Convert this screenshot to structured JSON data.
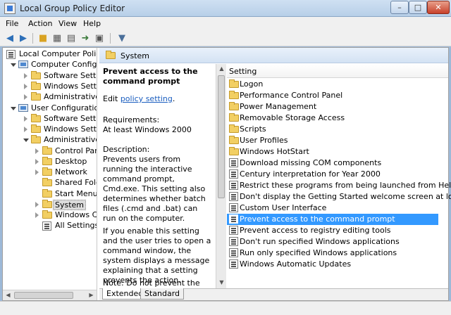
{
  "window": {
    "title": "Local Group Policy Editor",
    "controls": {
      "minimize": "–",
      "maximize": "□",
      "close": "✕"
    }
  },
  "menu": [
    "File",
    "Action",
    "View",
    "Help"
  ],
  "toolbar": {
    "icons": [
      "back-arrow-icon",
      "forward-arrow-icon",
      "folder-up-icon",
      "show-hide-tree-icon",
      "export-list-icon",
      "help-icon",
      "filter-icon"
    ]
  },
  "tree": {
    "items": [
      {
        "label": "Local Computer Policy",
        "icon": "policy-icon"
      },
      {
        "label": "Computer Configura",
        "icon": "computer-icon"
      },
      {
        "label": "Software Settings",
        "icon": "folder-icon"
      },
      {
        "label": "Windows Setting",
        "icon": "folder-icon"
      },
      {
        "label": "Administrative Te",
        "icon": "folder-icon"
      },
      {
        "label": "User Configuration",
        "icon": "computer-icon"
      },
      {
        "label": "Software Settings",
        "icon": "folder-icon"
      },
      {
        "label": "Windows Setting",
        "icon": "folder-icon"
      },
      {
        "label": "Administrative Te",
        "icon": "folder-icon"
      },
      {
        "label": "Control Panel",
        "icon": "folder-icon"
      },
      {
        "label": "Desktop",
        "icon": "folder-icon"
      },
      {
        "label": "Network",
        "icon": "folder-icon"
      },
      {
        "label": "Shared Folder",
        "icon": "folder-icon"
      },
      {
        "label": "Start Menu ar",
        "icon": "folder-icon"
      },
      {
        "label": "System",
        "icon": "folder-icon",
        "selected": true
      },
      {
        "label": "Windows Cor",
        "icon": "folder-icon"
      },
      {
        "label": "All Settings",
        "icon": "settings-icon"
      }
    ]
  },
  "panel": {
    "title": "System",
    "description": {
      "heading": "Prevent access to the command prompt",
      "edit_prefix": "Edit ",
      "edit_link": "policy setting",
      "edit_suffix": ".",
      "requirements_label": "Requirements:",
      "requirements_value": "At least Windows 2000",
      "description_label": "Description:",
      "description_p1": "Prevents users from running the interactive command prompt, Cmd.exe. This setting also determines whether batch files (.cmd and .bat) can run on the computer.",
      "description_p2": "If you enable this setting and the user tries to open a command window, the system displays a message explaining that a setting prevents the action.",
      "description_p3": "Note: Do not prevent the computer from running batch files if the computer uses logon"
    },
    "list_header": "Setting",
    "settings": [
      {
        "label": "Logon",
        "icon": "folder-icon"
      },
      {
        "label": "Performance Control Panel",
        "icon": "folder-icon"
      },
      {
        "label": "Power Management",
        "icon": "folder-icon"
      },
      {
        "label": "Removable Storage Access",
        "icon": "folder-icon"
      },
      {
        "label": "Scripts",
        "icon": "folder-icon"
      },
      {
        "label": "User Profiles",
        "icon": "folder-icon"
      },
      {
        "label": "Windows HotStart",
        "icon": "folder-icon"
      },
      {
        "label": "Download missing COM components",
        "icon": "setting-icon"
      },
      {
        "label": "Century interpretation for Year 2000",
        "icon": "setting-icon"
      },
      {
        "label": "Restrict these programs from being launched from Help",
        "icon": "setting-icon"
      },
      {
        "label": "Don't display the Getting Started welcome screen at logon",
        "icon": "setting-icon"
      },
      {
        "label": "Custom User Interface",
        "icon": "setting-icon"
      },
      {
        "label": "Prevent access to the command prompt",
        "icon": "setting-icon",
        "selected": true
      },
      {
        "label": "Prevent access to registry editing tools",
        "icon": "setting-icon"
      },
      {
        "label": "Don't run specified Windows applications",
        "icon": "setting-icon"
      },
      {
        "label": "Run only specified Windows applications",
        "icon": "setting-icon"
      },
      {
        "label": "Windows Automatic Updates",
        "icon": "setting-icon"
      }
    ],
    "tabs": [
      "Extended",
      "Standard"
    ]
  },
  "colors": {
    "selection": "#3399ff",
    "link": "#1a5dbf",
    "folder": "#f2cf63"
  }
}
